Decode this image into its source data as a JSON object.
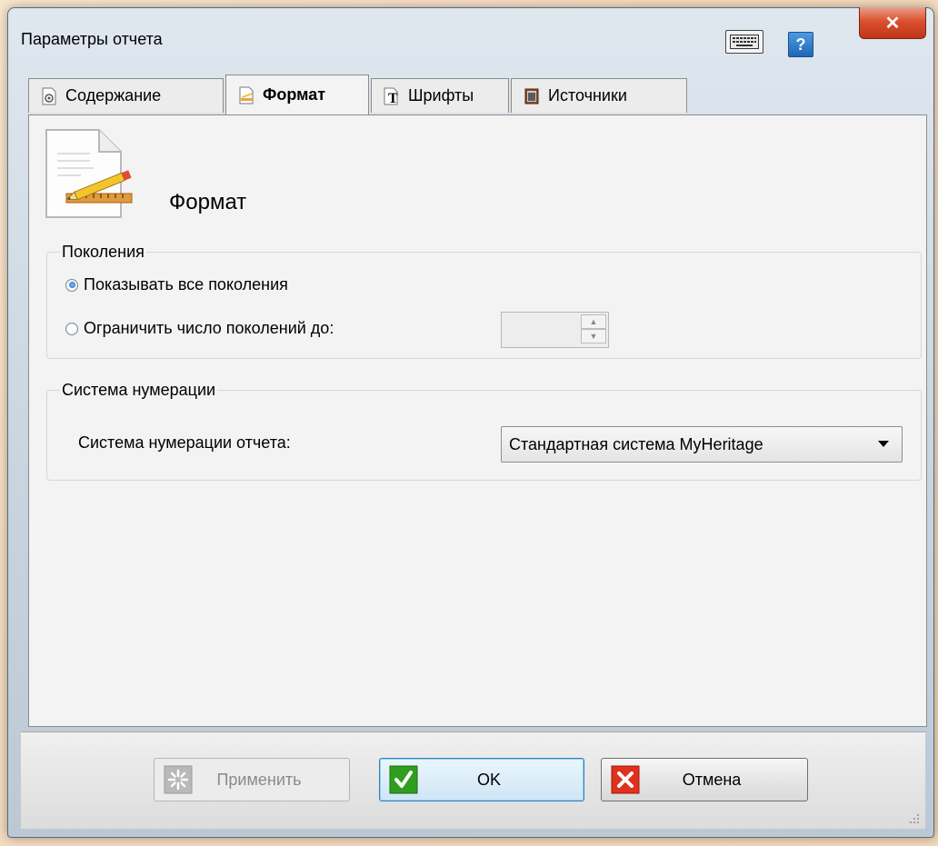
{
  "window": {
    "title": "Параметры отчета"
  },
  "tabs": [
    {
      "label": "Содержание",
      "icon": "gear-document-icon",
      "active": false
    },
    {
      "label": "Формат",
      "icon": "format-document-icon",
      "active": true
    },
    {
      "label": "Шрифты",
      "icon": "font-icon",
      "active": false
    },
    {
      "label": "Источники",
      "icon": "sources-book-icon",
      "active": false
    }
  ],
  "main": {
    "heading": "Формат",
    "generations": {
      "legend": "Поколения",
      "show_all_label": "Показывать все поколения",
      "limit_label": "Ограничить число поколений до:",
      "limit_value": ""
    },
    "numbering": {
      "legend": "Система нумерации",
      "label": "Система нумерации отчета:",
      "selected": "Стандартная система MyHeritage"
    }
  },
  "buttons": {
    "apply": "Применить",
    "ok": "OK",
    "cancel": "Отмена"
  },
  "colors": {
    "close_button": "#d9512e",
    "ok_icon": "#2f9e1f",
    "cancel_icon": "#e0301e"
  }
}
